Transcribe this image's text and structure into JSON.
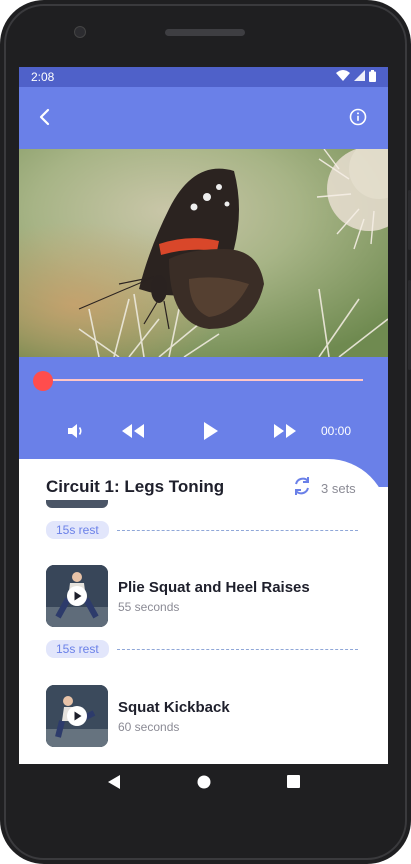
{
  "status_bar": {
    "time": "2:08"
  },
  "player": {
    "time": "00:00",
    "progress": 0
  },
  "circuit": {
    "title": "Circuit 1: Legs Toning",
    "sets": "3 sets"
  },
  "rest_label": "15s rest",
  "exercises": [
    {
      "name": "Plie Squat and Heel Raises",
      "duration": "55 seconds"
    },
    {
      "name": "Squat Kickback",
      "duration": "60 seconds"
    }
  ],
  "colors": {
    "primary": "#6a80e8",
    "status_bar": "#4f61c9",
    "seek_thumb": "#ff4d4d",
    "rest_pill_bg": "#e2e6fb"
  },
  "icons": {
    "back": "back-arrow-icon",
    "info": "info-icon",
    "volume": "volume-icon",
    "rewind": "rewind-icon",
    "play": "play-icon",
    "forward": "fast-forward-icon",
    "repeat": "repeat-icon"
  }
}
